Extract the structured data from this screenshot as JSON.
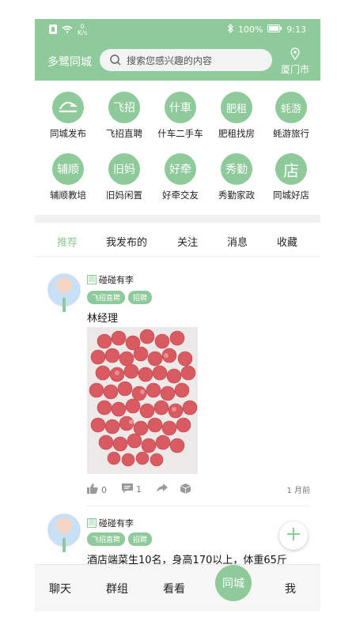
{
  "status_bar": {
    "battery": "100%",
    "time": "9:13",
    "net_speed_top": "0",
    "net_speed_bottom": "K/s"
  },
  "header": {
    "app_title": "多鹭同城",
    "search_placeholder": "搜索您感兴趣的内容",
    "city": "厦门市"
  },
  "category_grid": [
    {
      "label": "同城发布",
      "icon_text": "",
      "icon": "logo-swirl-icon"
    },
    {
      "label": "飞招直聘",
      "icon_text": "飞招",
      "icon": "flying-recruit-icon"
    },
    {
      "label": "什车二手车",
      "icon_text": "什車",
      "icon": "car-icon"
    },
    {
      "label": "肥租找房",
      "icon_text": "肥租",
      "icon": "house-icon"
    },
    {
      "label": "蚝游旅行",
      "icon_text": "蚝游",
      "icon": "travel-icon"
    },
    {
      "label": "辅顺教培",
      "icon_text": "辅顺",
      "icon": "education-icon"
    },
    {
      "label": "旧妈闲置",
      "icon_text": "旧妈",
      "icon": "secondhand-icon"
    },
    {
      "label": "好牵交友",
      "icon_text": "好牵",
      "icon": "friends-icon"
    },
    {
      "label": "秀勤家政",
      "icon_text": "秀勤",
      "icon": "housekeeping-icon"
    },
    {
      "label": "同城好店",
      "icon_text": "店",
      "icon": "shop-icon"
    }
  ],
  "tabs": [
    "推荐",
    "我发布的",
    "关注",
    "消息",
    "收藏"
  ],
  "posts": [
    {
      "username": "碰碰有李",
      "user_tag": "圆",
      "chips": [
        "飞招直聘",
        "招聘"
      ],
      "title": "林经理",
      "likes": "0",
      "comments": "1",
      "time": "1 月前"
    },
    {
      "username": "碰碰有李",
      "user_tag": "圆",
      "chips": [
        "飞招直聘",
        "招聘"
      ],
      "title": "酒店端菜生10名，身高170以上，体重65斤"
    }
  ],
  "bottom_nav": [
    "聊天",
    "群组",
    "看看",
    "同城",
    "我"
  ],
  "colors": {
    "accent": "#8fca9a",
    "text": "#222222",
    "muted": "#777777"
  }
}
